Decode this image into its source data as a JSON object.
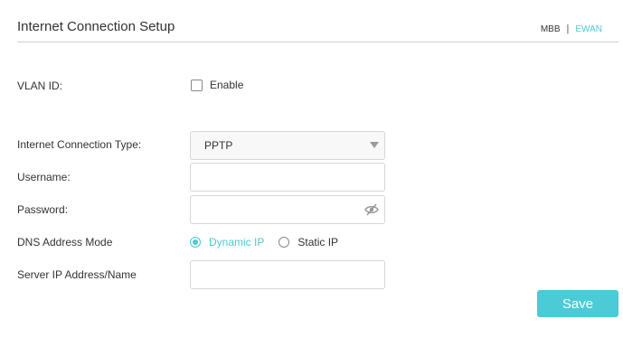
{
  "header": {
    "title": "Internet Connection Setup",
    "modes": {
      "mbb": "MBB",
      "separator": "|",
      "ewan": "EWAN",
      "active": "EWAN"
    }
  },
  "vlan": {
    "label": "VLAN ID:",
    "enable_label": "Enable",
    "enabled": false
  },
  "connection_type": {
    "label": "Internet Connection Type:",
    "value": "PPTP"
  },
  "username": {
    "label": "Username:",
    "value": ""
  },
  "password": {
    "label": "Password:",
    "value": "",
    "toggle_icon": "eye-slash-icon"
  },
  "dns_mode": {
    "label": "DNS Address Mode",
    "options": [
      {
        "label": "Dynamic IP",
        "checked": true
      },
      {
        "label": "Static IP",
        "checked": false
      }
    ]
  },
  "server": {
    "label": "Server IP Address/Name",
    "value": ""
  },
  "actions": {
    "save_label": "Save"
  },
  "colors": {
    "accent": "#4acbd6",
    "text": "#333333",
    "border": "#d6d6d6"
  }
}
